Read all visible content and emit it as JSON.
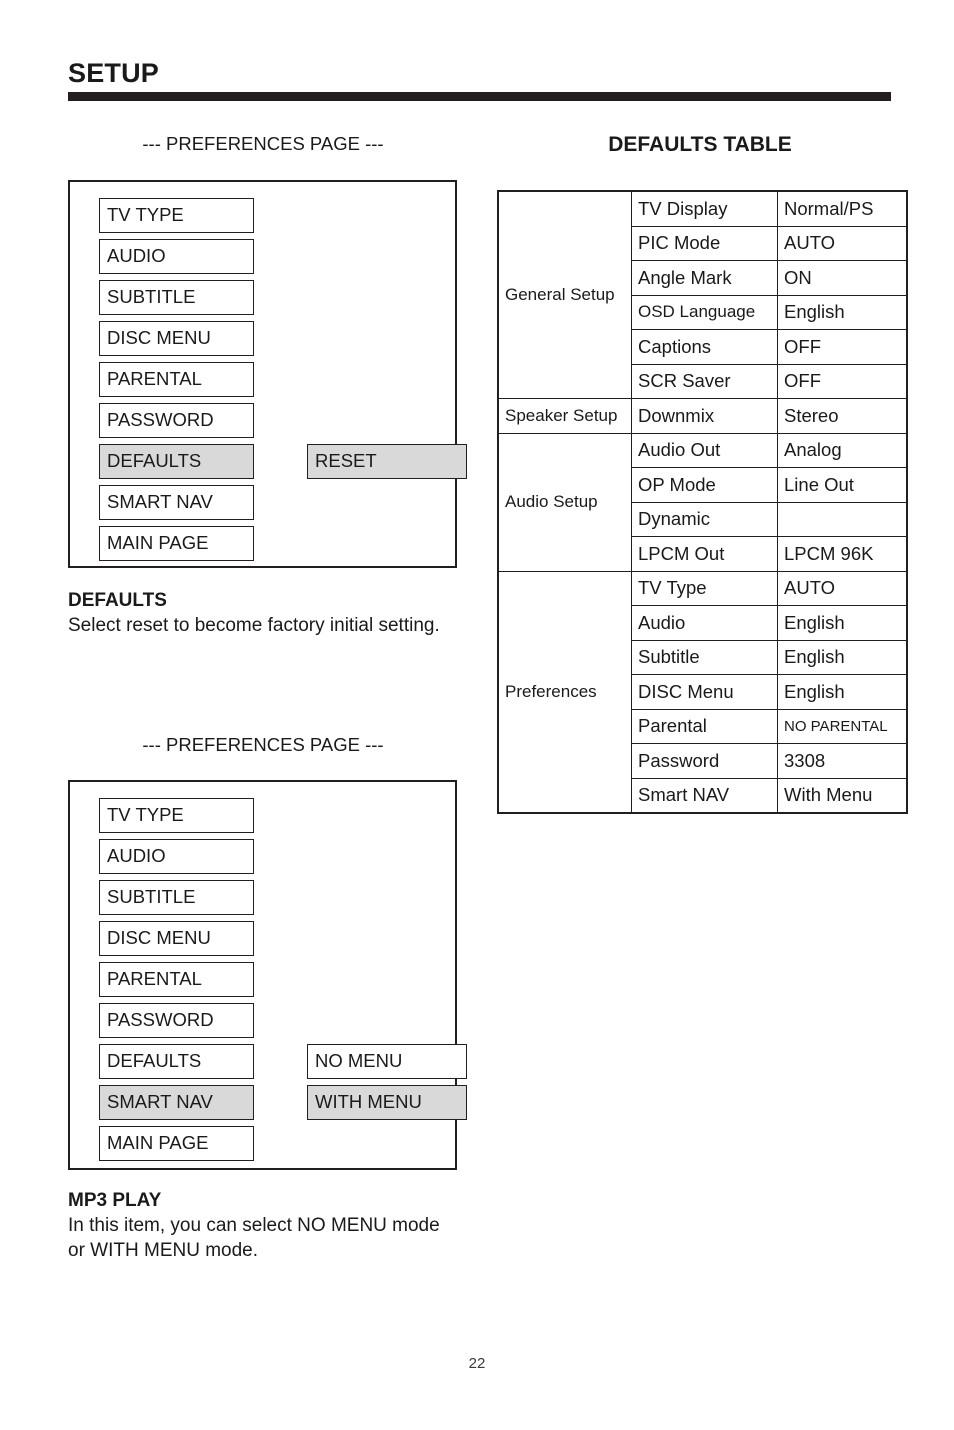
{
  "header": {
    "title": "SETUP"
  },
  "footer": {
    "page_number": "22"
  },
  "colors": {
    "highlight": "#d9d9d9",
    "ink": "#231f20",
    "paper": "#ffffff"
  },
  "left_column": {
    "panel_one": {
      "caption": "--- PREFERENCES PAGE ---",
      "items": [
        {
          "label": "TV TYPE",
          "selected": false,
          "sub": null
        },
        {
          "label": "AUDIO",
          "selected": false,
          "sub": null
        },
        {
          "label": "SUBTITLE",
          "selected": false,
          "sub": null
        },
        {
          "label": "DISC MENU",
          "selected": false,
          "sub": null
        },
        {
          "label": "PARENTAL",
          "selected": false,
          "sub": null
        },
        {
          "label": "PASSWORD",
          "selected": false,
          "sub": null
        },
        {
          "label": "DEFAULTS",
          "selected": true,
          "sub": {
            "label": "RESET",
            "selected": true
          }
        },
        {
          "label": "SMART NAV",
          "selected": false,
          "sub": null
        },
        {
          "label": "MAIN PAGE",
          "selected": false,
          "sub": null
        }
      ]
    },
    "description_one": {
      "title": "DEFAULTS",
      "body": "Select reset to become factory initial setting."
    },
    "panel_two": {
      "caption": "--- PREFERENCES PAGE ---",
      "items": [
        {
          "label": "TV TYPE",
          "selected": false,
          "sub": null
        },
        {
          "label": "AUDIO",
          "selected": false,
          "sub": null
        },
        {
          "label": "SUBTITLE",
          "selected": false,
          "sub": null
        },
        {
          "label": "DISC MENU",
          "selected": false,
          "sub": null
        },
        {
          "label": "PARENTAL",
          "selected": false,
          "sub": null
        },
        {
          "label": "PASSWORD",
          "selected": false,
          "sub": null
        },
        {
          "label": "DEFAULTS",
          "selected": false,
          "sub": {
            "label": "NO MENU",
            "selected": false
          }
        },
        {
          "label": "SMART NAV",
          "selected": true,
          "sub": {
            "label": "WITH MENU",
            "selected": true
          }
        },
        {
          "label": "MAIN PAGE",
          "selected": false,
          "sub": null
        }
      ]
    },
    "description_two": {
      "title": "MP3 PLAY",
      "body": "In this item, you can select NO MENU mode or WITH MENU mode."
    }
  },
  "right_column": {
    "table_title": "DEFAULTS TABLE",
    "table_rows": [
      {
        "group": "General Setup",
        "item": "TV Display",
        "value": "Normal/PS",
        "value_small": false,
        "group_small": true
      },
      {
        "group": "",
        "item": "PIC Mode",
        "value": "AUTO",
        "value_small": false,
        "group_small": false
      },
      {
        "group": "",
        "item": "Angle Mark",
        "value": "ON",
        "value_small": false,
        "group_small": false
      },
      {
        "group": "",
        "item": "OSD Language",
        "value": "English",
        "value_small": false,
        "group_small": false,
        "item_small": true
      },
      {
        "group": "",
        "item": "Captions",
        "value": "OFF",
        "value_small": false,
        "group_small": false
      },
      {
        "group": "",
        "item": "SCR Saver",
        "value": "OFF",
        "value_small": false,
        "group_small": false
      },
      {
        "group": "Speaker Setup",
        "item": "Downmix",
        "value": "Stereo",
        "value_small": false,
        "group_small": true
      },
      {
        "group": "Audio Setup",
        "item": "Audio Out",
        "value": "Analog",
        "value_small": false,
        "group_small": true
      },
      {
        "group": "",
        "item": "OP Mode",
        "value": "Line Out",
        "value_small": false,
        "group_small": false
      },
      {
        "group": "",
        "item": "Dynamic",
        "value": "",
        "value_small": false,
        "group_small": false
      },
      {
        "group": "",
        "item": "LPCM Out",
        "value": "LPCM 96K",
        "value_small": false,
        "group_small": false
      },
      {
        "group": "Preferences",
        "item": "TV Type",
        "value": "AUTO",
        "value_small": false,
        "group_small": true
      },
      {
        "group": "",
        "item": "Audio",
        "value": "English",
        "value_small": false,
        "group_small": false
      },
      {
        "group": "",
        "item": "Subtitle",
        "value": "English",
        "value_small": false,
        "group_small": false
      },
      {
        "group": "",
        "item": "DISC Menu",
        "value": "English",
        "value_small": false,
        "group_small": false
      },
      {
        "group": "",
        "item": "Parental",
        "value": "NO PARENTAL",
        "value_small": true,
        "group_small": false
      },
      {
        "group": "",
        "item": "Password",
        "value": "3308",
        "value_small": false,
        "group_small": false
      },
      {
        "group": "",
        "item": "Smart NAV",
        "value": "With Menu",
        "value_small": false,
        "group_small": false
      }
    ]
  }
}
